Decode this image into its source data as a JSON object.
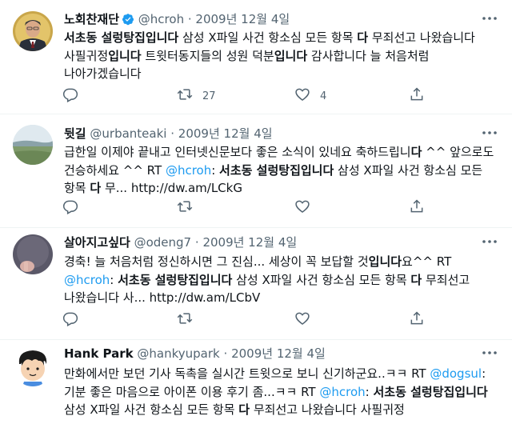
{
  "tweets": [
    {
      "name": "노회찬재단",
      "handle": "@hcroh",
      "date": "2009년 12월 4일",
      "verified": true,
      "body": [
        {
          "t": "서초동 설렁탕집입니다",
          "b": true
        },
        {
          "t": " 삼성 X파일 사건 항소심 모든 항목 "
        },
        {
          "t": "다",
          "b": true
        },
        {
          "t": " 무죄선고 나왔습니다 사필귀정"
        },
        {
          "t": "입니다",
          "b": true
        },
        {
          "t": " 트윗터동지들의 성원 덕분"
        },
        {
          "t": "입니다",
          "b": true
        },
        {
          "t": " 감사합니다 늘 처음처럼 나아가겠습니다"
        }
      ],
      "reply_count": "",
      "retweet_count": "27",
      "like_count": "4"
    },
    {
      "name": "뒷길",
      "handle": "@urbanteaki",
      "date": "2009년 12월 4일",
      "verified": false,
      "body": [
        {
          "t": "급한일 이제야 끝내고 인터넷신문보다 좋은 소식이 있네요 축하드립니"
        },
        {
          "t": "다",
          "b": true
        },
        {
          "t": " ^^ 앞으로도 건승하세요 ^^ RT "
        },
        {
          "t": "@hcroh",
          "m": true
        },
        {
          "t": ": "
        },
        {
          "t": "서초동 설렁탕집입니다",
          "b": true
        },
        {
          "t": " 삼성 X파일 사건 항소심 모든 항목 "
        },
        {
          "t": "다",
          "b": true
        },
        {
          "t": " 무... http://dw.am/LCkG"
        }
      ],
      "reply_count": "",
      "retweet_count": "",
      "like_count": ""
    },
    {
      "name": "살아지고싶다",
      "handle": "@odeng7",
      "date": "2009년 12월 4일",
      "verified": false,
      "body": [
        {
          "t": "경축! 늘 처음처럼 정신하시면 그 진심... 세상이 꼭 보답할 것"
        },
        {
          "t": "입니다",
          "b": true
        },
        {
          "t": "요^^ RT "
        },
        {
          "t": "@hcroh",
          "m": true
        },
        {
          "t": ": "
        },
        {
          "t": "서초동 설렁탕집입니다",
          "b": true
        },
        {
          "t": " 삼성 X파일 사건 항소심 모든 항목 "
        },
        {
          "t": "다",
          "b": true
        },
        {
          "t": " 무죄선고 나왔습니다 사... http://dw.am/LCbV"
        }
      ],
      "reply_count": "",
      "retweet_count": "",
      "like_count": ""
    },
    {
      "name": "Hank Park",
      "handle": "@hankyupark",
      "date": "2009년 12월 4일",
      "verified": false,
      "body": [
        {
          "t": "만화에서만 보던 기사 독촉을 실시간 트윗으로 보니 신기하군요..ㅋㅋ RT "
        },
        {
          "t": "@dogsul",
          "m": true
        },
        {
          "t": ": 기분 좋은 마음으로 아이폰 이용 후기 좀...ㅋㅋ RT "
        },
        {
          "t": "@hcroh",
          "m": true
        },
        {
          "t": ": "
        },
        {
          "t": "서초동 설렁탕집입니다",
          "b": true
        },
        {
          "t": " 삼성 X파일 사건 항소심 모든 항목 "
        },
        {
          "t": "다",
          "b": true
        },
        {
          "t": " 무죄선고 나왔습니다 사필귀정"
        }
      ],
      "reply_count": "",
      "retweet_count": "",
      "like_count": ""
    }
  ],
  "separator": "·",
  "icons": {
    "reply": "reply-icon",
    "retweet": "retweet-icon",
    "like": "like-icon",
    "share": "share-icon",
    "more": "more-icon",
    "verified": "verified-badge-icon"
  },
  "colors": {
    "text": "#0f1419",
    "secondary": "#536471",
    "link": "#1d9bf0",
    "verified": "#1d9bf0",
    "divider": "#eff3f4"
  }
}
